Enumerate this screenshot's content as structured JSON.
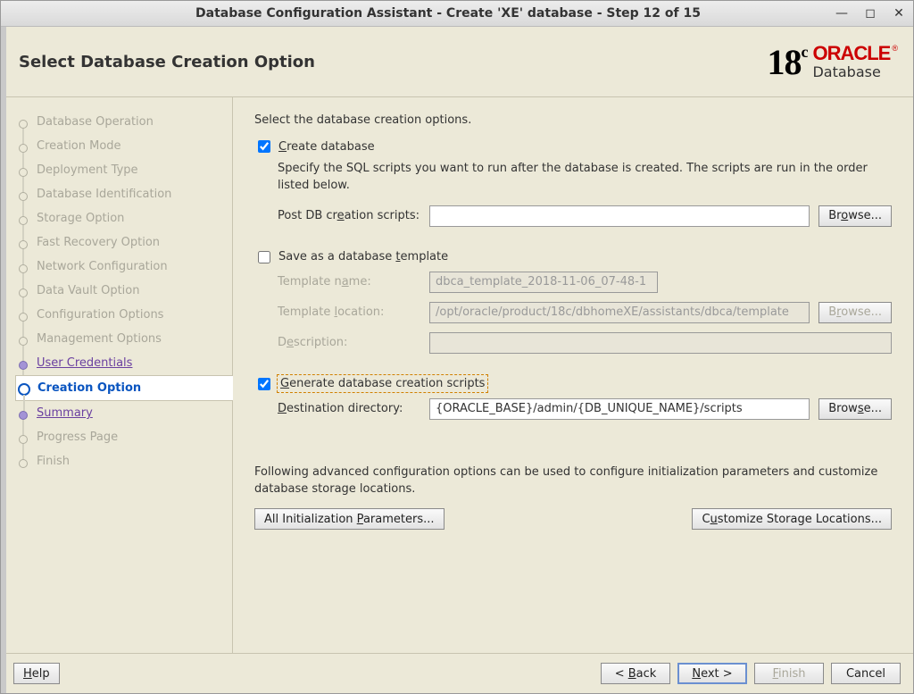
{
  "window": {
    "title": "Database Configuration Assistant - Create 'XE' database - Step 12 of 15"
  },
  "header": {
    "page_title": "Select Database Creation Option",
    "logo_version": "18",
    "logo_c": "c",
    "brand": "ORACLE",
    "product": "Database"
  },
  "sidebar": {
    "items": [
      {
        "label": "Database Operation",
        "state": "future"
      },
      {
        "label": "Creation Mode",
        "state": "future"
      },
      {
        "label": "Deployment Type",
        "state": "future"
      },
      {
        "label": "Database Identification",
        "state": "future"
      },
      {
        "label": "Storage Option",
        "state": "future"
      },
      {
        "label": "Fast Recovery Option",
        "state": "future"
      },
      {
        "label": "Network Configuration",
        "state": "future"
      },
      {
        "label": "Data Vault Option",
        "state": "future"
      },
      {
        "label": "Configuration Options",
        "state": "future"
      },
      {
        "label": "Management Options",
        "state": "future"
      },
      {
        "label": "User Credentials",
        "state": "visited"
      },
      {
        "label": "Creation Option",
        "state": "current"
      },
      {
        "label": "Summary",
        "state": "visited"
      },
      {
        "label": "Progress Page",
        "state": "future"
      },
      {
        "label": "Finish",
        "state": "future"
      }
    ]
  },
  "main": {
    "intro": "Select the database creation options.",
    "create_db": {
      "label": "Create database",
      "checked": true,
      "desc": "Specify the SQL scripts you want to run after the database is created. The scripts are run in the order listed below.",
      "post_label": "Post DB creation scripts:",
      "post_value": "",
      "browse": "Browse..."
    },
    "save_tmpl": {
      "label": "Save as a database template",
      "checked": false,
      "name_label": "Template name:",
      "name_value": "dbca_template_2018-11-06_07-48-1",
      "loc_label": "Template location:",
      "loc_value": "/opt/oracle/product/18c/dbhomeXE/assistants/dbca/template",
      "desc_label": "Description:",
      "desc_value": "",
      "browse": "Browse..."
    },
    "gen_scripts": {
      "label": "Generate database creation scripts",
      "checked": true,
      "dest_label": "Destination directory:",
      "dest_value": "{ORACLE_BASE}/admin/{DB_UNIQUE_NAME}/scripts",
      "browse": "Browse..."
    },
    "advanced": {
      "text": "Following advanced configuration options can be used to configure initialization parameters and customize database storage locations.",
      "init_btn": "All Initialization Parameters...",
      "storage_btn": "Customize Storage Locations..."
    }
  },
  "footer": {
    "help": "Help",
    "back": "< Back",
    "next": "Next >",
    "finish": "Finish",
    "cancel": "Cancel"
  }
}
